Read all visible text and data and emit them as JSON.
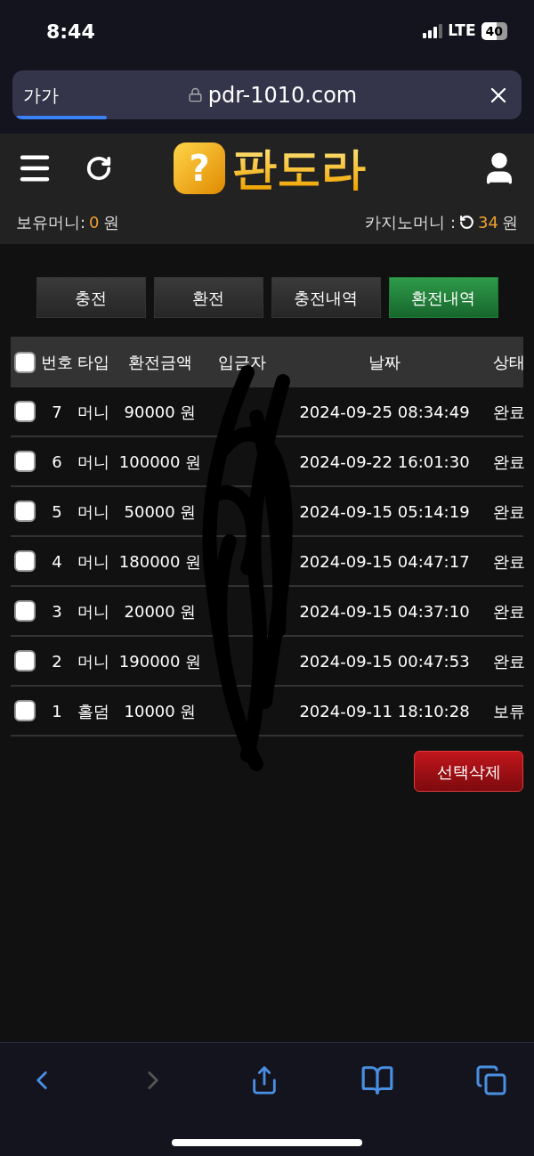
{
  "status_bar": {
    "time": "8:44",
    "network": "LTE",
    "battery": "40"
  },
  "browser": {
    "text_size_button": "가가",
    "url": "pdr-1010.com",
    "progress": {
      "level": 0.18
    }
  },
  "header": {
    "logo_mark": "?",
    "logo_text": "판도라"
  },
  "balances": {
    "own_label": "보유머니:",
    "own_value": "0",
    "own_unit": "원",
    "casino_label": "카지노머니 :",
    "casino_value": "34",
    "casino_unit": "원"
  },
  "tabs": [
    {
      "label": "충전",
      "selected": false
    },
    {
      "label": "환전",
      "selected": false
    },
    {
      "label": "충전내역",
      "selected": false
    },
    {
      "label": "환전내역",
      "selected": true
    }
  ],
  "table": {
    "select_all_checked": false,
    "columns": [
      "번호",
      "타입",
      "환전금액",
      "입금자",
      "날짜",
      "상태"
    ],
    "rows": [
      {
        "checked": false,
        "no": "7",
        "type": "머니",
        "amount": "90000 원",
        "date": "2024-09-25 08:34:49",
        "status": "완료"
      },
      {
        "checked": false,
        "no": "6",
        "type": "머니",
        "amount": "100000 원",
        "date": "2024-09-22 16:01:30",
        "status": "완료"
      },
      {
        "checked": false,
        "no": "5",
        "type": "머니",
        "amount": "50000 원",
        "date": "2024-09-15 05:14:19",
        "status": "완료"
      },
      {
        "checked": false,
        "no": "4",
        "type": "머니",
        "amount": "180000 원",
        "date": "2024-09-15 04:47:17",
        "status": "완료"
      },
      {
        "checked": false,
        "no": "3",
        "type": "머니",
        "amount": "20000 원",
        "date": "2024-09-15 04:37:10",
        "status": "완료"
      },
      {
        "checked": false,
        "no": "2",
        "type": "머니",
        "amount": "190000 원",
        "date": "2024-09-15 00:47:53",
        "status": "완료"
      },
      {
        "checked": false,
        "no": "1",
        "type": "홀덤",
        "amount": "10000 원",
        "date": "2024-09-11 18:10:28",
        "status": "보류"
      }
    ]
  },
  "delete_button": "선택삭제"
}
